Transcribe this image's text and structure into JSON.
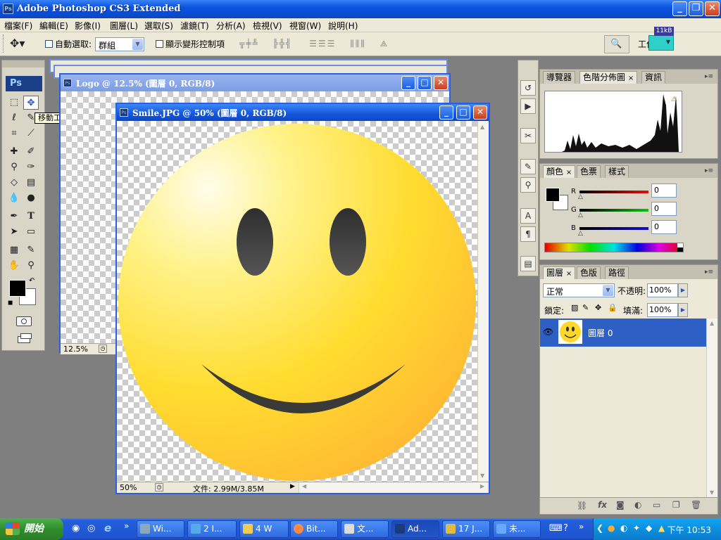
{
  "app": {
    "title": "Adobe Photoshop CS3 Extended",
    "icon": "Ps",
    "window_buttons": [
      "minimize",
      "restore",
      "close"
    ]
  },
  "menu": [
    "檔案(F)",
    "編輯(E)",
    "影像(I)",
    "圖層(L)",
    "選取(S)",
    "濾鏡(T)",
    "分析(A)",
    "檢視(V)",
    "視窗(W)",
    "說明(H)"
  ],
  "options_bar": {
    "auto_select_label": "自動選取:",
    "auto_select_value": "群組",
    "show_transform_label": "顯示變形控制項",
    "workspace_label": "工作區",
    "kb_badge": "11kB"
  },
  "toolbox": {
    "badge": "Ps",
    "tooltip": "移動工具 (V)"
  },
  "doc_back": {
    "title": "Logo @ 12.5% (圖層 0, RGB/8)",
    "zoom": "12.5%"
  },
  "doc_front": {
    "title": "Smile.JPG @ 50% (圖層 0, RGB/8)",
    "zoom": "50%",
    "status": "文件: 2.99M/3.85M"
  },
  "panel_histogram": {
    "tabs": [
      "導覽器",
      "色階分佈圖",
      "資訊"
    ],
    "active_tab": "色階分佈圖"
  },
  "panel_color": {
    "tabs": [
      "顏色",
      "色票",
      "樣式"
    ],
    "active_tab": "顏色",
    "channels": [
      {
        "label": "R",
        "value": "0",
        "color": "#d01818"
      },
      {
        "label": "G",
        "value": "0",
        "color": "#18b018"
      },
      {
        "label": "B",
        "value": "0",
        "color": "#1818c8"
      }
    ]
  },
  "panel_layers": {
    "tabs": [
      "圖層",
      "色版",
      "路徑"
    ],
    "active_tab": "圖層",
    "blend_mode": "正常",
    "opacity_label": "不透明:",
    "opacity_value": "100%",
    "lock_label": "鎖定:",
    "fill_label": "填滿:",
    "fill_value": "100%",
    "layers": [
      {
        "name": "圖層 0",
        "selected": true,
        "visible": true
      }
    ]
  },
  "taskbar": {
    "start_label": "開始",
    "items": [
      {
        "label": "Wi...",
        "active": false
      },
      {
        "label": "2 I...",
        "active": false
      },
      {
        "label": "4 W",
        "active": false
      },
      {
        "label": "Bit...",
        "active": false
      },
      {
        "label": "文...",
        "active": false
      },
      {
        "label": "Ad...",
        "active": true
      },
      {
        "label": "17 J...",
        "active": false
      },
      {
        "label": "未...",
        "active": false
      }
    ],
    "clock": "下午 10:53"
  },
  "colors": {
    "xp_blue": "#0a54e0",
    "panel_bg": "#d9d6c8",
    "layer_selected": "#2d5fc4",
    "smiley_yellow": "#ffd82a"
  }
}
